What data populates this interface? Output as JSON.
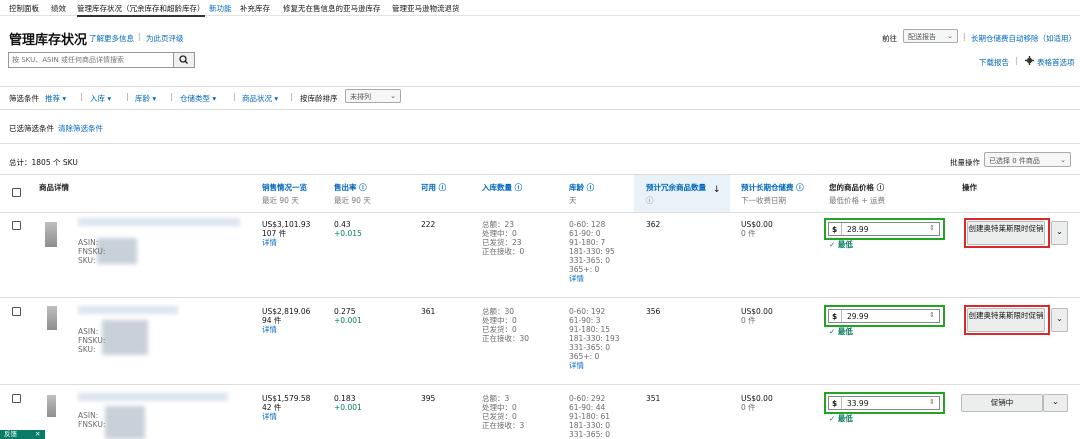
{
  "nav": {
    "items": [
      "控制面板",
      "绩效",
      "管理库存状况（冗余库存和超龄库存）",
      "新功能",
      "补充库存",
      "修复无在售信息的亚马逊库存",
      "管理亚马逊物流退货"
    ],
    "active_index": 2,
    "new_badge_index": 3
  },
  "header": {
    "title": "管理库存状况",
    "learn_more": "了解更多信息",
    "rate_page": "为此页评级",
    "goto_label": "前往",
    "goto_select": "配送报告",
    "long_term_fee": "长期仓储费自动移除（如适用）",
    "download_report": "下载报告",
    "table_prefs": "表格首选项"
  },
  "search": {
    "placeholder": "按 SKU、ASIN 或任何商品详情搜索"
  },
  "filters": {
    "label": "筛选条件",
    "items": [
      "推荐",
      "入库",
      "库龄",
      "仓储类型",
      "商品状况"
    ],
    "sort_label": "按库龄排序",
    "sort_value": "未排列",
    "applied_label": "已选筛选条件",
    "clear_label": "清除筛选条件"
  },
  "summary": {
    "total": "总计：1805 个 SKU",
    "bulk_label": "批量操作",
    "bulk_select": "已选择 0 件商品"
  },
  "columns": {
    "product": "商品详情",
    "sales": "销售情况一览",
    "sales_sub": "最近 90 天",
    "sell_through": "售出率 ⓘ",
    "sell_through_sub": "最近 90 天",
    "available": "可用 ⓘ",
    "inbound": "入库数量 ⓘ",
    "age": "库龄 ⓘ",
    "age_sub": "天",
    "excess": "预计冗余商品数量",
    "excess_sub": "ⓘ",
    "ltsf": "预计长期仓储费 ⓘ",
    "ltsf_sub": "下一收费日期",
    "your_price": "您的商品价格 ⓘ",
    "your_price_sub": "最低价格 + 运费",
    "action": "操作"
  },
  "rows": [
    {
      "asin_label": "ASIN:",
      "fnsku_label": "FNSKU:",
      "sku_label": "SKU:",
      "sales_amount": "US$3,101.93",
      "sales_units": "107 件",
      "detail_link": "详情",
      "sell_through": "0.43",
      "sell_through_delta": "+0.015",
      "available": "222",
      "inbound": [
        "总额：23",
        "处理中：0",
        "已发货：23",
        "正在接收：0"
      ],
      "age": [
        "0-60: 128",
        "61-90: 0",
        "91-180: 7",
        "181-330: 95",
        "331-365: 0",
        "365+: 0",
        "详情"
      ],
      "excess": "362",
      "ltsf": "US$0.00",
      "ltsf_units": "0 件",
      "currency": "$",
      "price": "28.99",
      "lowest": "✓ 最低",
      "action": "创建奥特莱斯限时促销"
    },
    {
      "asin_label": "ASIN:",
      "fnsku_label": "FNSKU:",
      "sku_label": "SKU:",
      "sales_amount": "US$2,819.06",
      "sales_units": "94 件",
      "detail_link": "详情",
      "sell_through": "0.275",
      "sell_through_delta": "+0.001",
      "available": "361",
      "inbound": [
        "总额：30",
        "处理中：0",
        "已发货：0",
        "正在接收：30"
      ],
      "age": [
        "0-60: 192",
        "61-90: 3",
        "91-180: 15",
        "181-330: 193",
        "331-365: 0",
        "365+: 0",
        "详情"
      ],
      "excess": "356",
      "ltsf": "US$0.00",
      "ltsf_units": "0 件",
      "currency": "$",
      "price": "29.99",
      "lowest": "✓ 最低",
      "action": "创建奥特莱斯限时促销"
    },
    {
      "asin_label": "ASIN:",
      "fnsku_label": "FNSKU:",
      "sku_label": "SKU:",
      "sales_amount": "US$1,579.58",
      "sales_units": "42 件",
      "detail_link": "详情",
      "sell_through": "0.183",
      "sell_through_delta": "+0.001",
      "available": "395",
      "inbound": [
        "总额：3",
        "处理中：0",
        "已发货：0",
        "正在接收：3"
      ],
      "age": [
        "0-60: 292",
        "61-90: 44",
        "91-180: 61",
        "181-330: 0",
        "331-365: 0"
      ],
      "excess": "351",
      "ltsf": "US$0.00",
      "ltsf_units": "0 件",
      "currency": "$",
      "price": "33.99",
      "lowest": "✓ 最低",
      "action": "促销中"
    }
  ],
  "toast": {
    "label": "反馈",
    "close": "✕"
  },
  "colors": {
    "link": "#0066c0",
    "highlight_green": "#23a523",
    "highlight_red": "#d9292b",
    "positive": "#067d62"
  }
}
